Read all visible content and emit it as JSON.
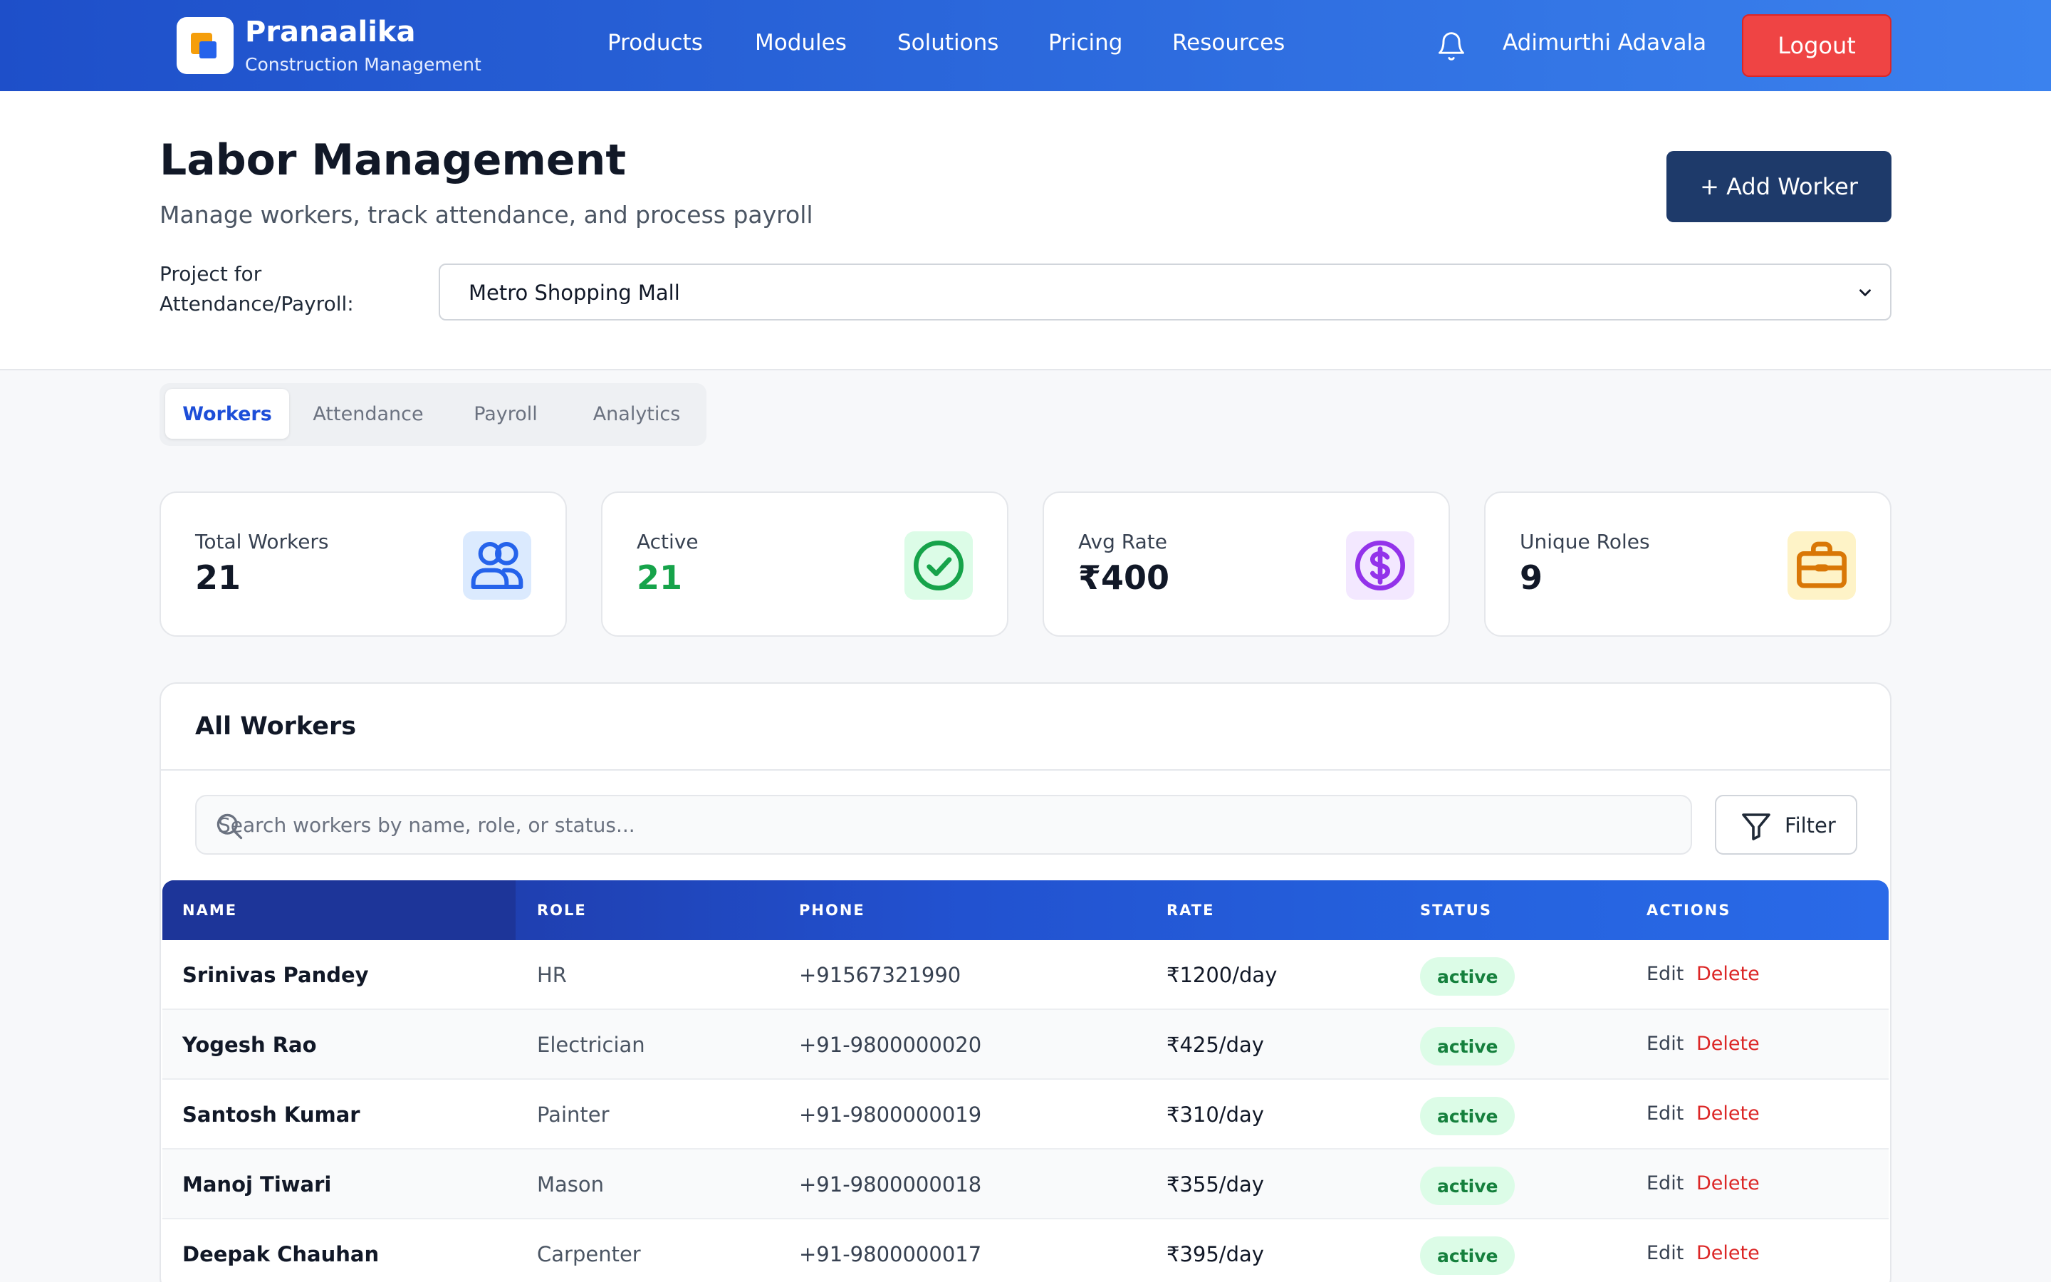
{
  "brand": {
    "name": "Pranaalika",
    "subtitle": "Construction Management"
  },
  "nav": {
    "items": [
      "Products",
      "Modules",
      "Solutions",
      "Pricing",
      "Resources"
    ]
  },
  "user": {
    "name": "Adimurthi Adavala",
    "logout_label": "Logout"
  },
  "header": {
    "title": "Labor Management",
    "subtitle": "Manage workers, track attendance, and process payroll",
    "add_button": "+ Add Worker",
    "project_label": "Project for Attendance/Payroll:",
    "project_selected": "Metro Shopping Mall"
  },
  "tabs": [
    "Workers",
    "Attendance",
    "Payroll",
    "Analytics"
  ],
  "active_tab": "Workers",
  "stats": [
    {
      "label": "Total Workers",
      "value": "21",
      "icon": "users-icon",
      "color": "#2563eb"
    },
    {
      "label": "Active",
      "value": "21",
      "icon": "check-circle-icon",
      "color": "#16a34a"
    },
    {
      "label": "Avg Rate",
      "value": "₹400",
      "icon": "dollar-circle-icon",
      "color": "#9333ea"
    },
    {
      "label": "Unique Roles",
      "value": "9",
      "icon": "briefcase-icon",
      "color": "#d97706"
    }
  ],
  "table": {
    "title": "All Workers",
    "search_placeholder": "Search workers by name, role, or status...",
    "filter_label": "Filter",
    "columns": [
      "NAME",
      "ROLE",
      "PHONE",
      "RATE",
      "STATUS",
      "ACTIONS"
    ],
    "edit_label": "Edit",
    "delete_label": "Delete",
    "rows": [
      {
        "name": "Srinivas Pandey",
        "role": "HR",
        "phone": "+91567321990",
        "rate": "₹1200/day",
        "status": "active"
      },
      {
        "name": "Yogesh Rao",
        "role": "Electrician",
        "phone": "+91-9800000020",
        "rate": "₹425/day",
        "status": "active"
      },
      {
        "name": "Santosh Kumar",
        "role": "Painter",
        "phone": "+91-9800000019",
        "rate": "₹310/day",
        "status": "active"
      },
      {
        "name": "Manoj Tiwari",
        "role": "Mason",
        "phone": "+91-9800000018",
        "rate": "₹355/day",
        "status": "active"
      },
      {
        "name": "Deepak Chauhan",
        "role": "Carpenter",
        "phone": "+91-9800000017",
        "rate": "₹395/day",
        "status": "active"
      }
    ]
  }
}
